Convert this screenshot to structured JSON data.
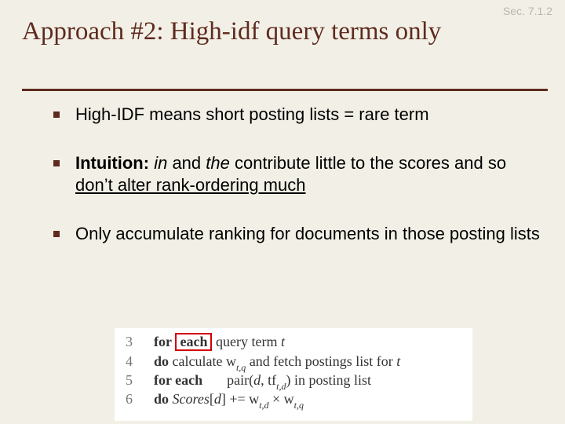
{
  "section_label": "Sec. 7.1.2",
  "title": "Approach #2: High-idf query terms only",
  "bullets": [
    {
      "text": "High-IDF means short posting lists = rare term"
    },
    {
      "lead_bold": "Intuition:",
      "it1": "in",
      "mid1": " and ",
      "it2": "the",
      "mid2": " contribute little to the scores and so ",
      "tail_underline": "don’t alter rank-ordering much"
    },
    {
      "text": "Only accumulate ranking for documents in those posting lists"
    }
  ],
  "algo": {
    "lines": [
      {
        "num": "3",
        "kw": "for",
        "boxed": "each",
        "rest_pre": " query term ",
        "var": "t"
      },
      {
        "num": "4",
        "kw": "do",
        "rest": " calculate w",
        "sub": "t,q",
        "rest2": " and fetch postings list for ",
        "var": "t"
      },
      {
        "num": "5",
        "kw": "for   each",
        "rest_pre": " pair(",
        "var1": "d",
        "mid": ", tf",
        "sub": "t,d",
        "rest2": ") in posting list"
      },
      {
        "num": "6",
        "kw": "do",
        "lhs_pre": " ",
        "score": "Scores",
        "idx_open": "[",
        "idx_var": "d",
        "idx_close": "]",
        "op": " += w",
        "sub1": "t,d",
        "times": " × w",
        "sub2": "t,q"
      }
    ]
  }
}
